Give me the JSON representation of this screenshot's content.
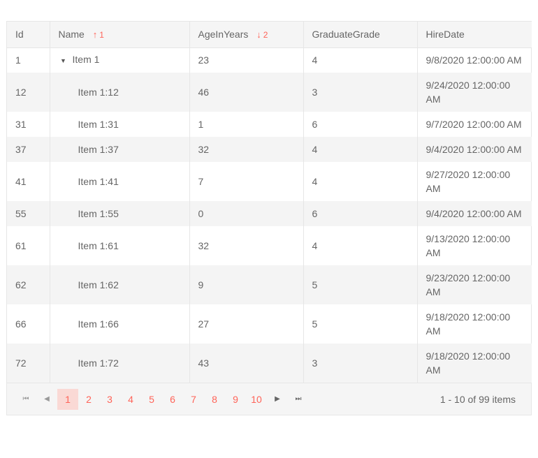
{
  "columns": [
    {
      "label": "Id"
    },
    {
      "label": "Name",
      "sort": {
        "direction": "asc",
        "arrow": "↑",
        "order": "1"
      }
    },
    {
      "label": "AgeInYears",
      "sort": {
        "direction": "desc",
        "arrow": "↓",
        "order": "2"
      }
    },
    {
      "label": "GraduateGrade"
    },
    {
      "label": "HireDate"
    }
  ],
  "rows": [
    {
      "id": "1",
      "name": "Item 1",
      "age": "23",
      "grade": "4",
      "hire": "9/8/2020 12:00:00 AM",
      "expander": "▼"
    },
    {
      "id": "12",
      "name": "Item 1:12",
      "age": "46",
      "grade": "3",
      "hire": "9/24/2020 12:00:00 AM"
    },
    {
      "id": "31",
      "name": "Item 1:31",
      "age": "1",
      "grade": "6",
      "hire": "9/7/2020 12:00:00 AM"
    },
    {
      "id": "37",
      "name": "Item 1:37",
      "age": "32",
      "grade": "4",
      "hire": "9/4/2020 12:00:00 AM"
    },
    {
      "id": "41",
      "name": "Item 1:41",
      "age": "7",
      "grade": "4",
      "hire": "9/27/2020 12:00:00 AM"
    },
    {
      "id": "55",
      "name": "Item 1:55",
      "age": "0",
      "grade": "6",
      "hire": "9/4/2020 12:00:00 AM"
    },
    {
      "id": "61",
      "name": "Item 1:61",
      "age": "32",
      "grade": "4",
      "hire": "9/13/2020 12:00:00 AM"
    },
    {
      "id": "62",
      "name": "Item 1:62",
      "age": "9",
      "grade": "5",
      "hire": "9/23/2020 12:00:00 AM"
    },
    {
      "id": "66",
      "name": "Item 1:66",
      "age": "27",
      "grade": "5",
      "hire": "9/18/2020 12:00:00 AM"
    },
    {
      "id": "72",
      "name": "Item 1:72",
      "age": "43",
      "grade": "3",
      "hire": "9/18/2020 12:00:00 AM"
    }
  ],
  "pager": {
    "first_icon": "⏮",
    "prev_icon": "◀",
    "next_icon": "▶",
    "last_icon": "⏭",
    "pages": [
      "1",
      "2",
      "3",
      "4",
      "5",
      "6",
      "7",
      "8",
      "9",
      "10"
    ],
    "current_page": "1",
    "info": "1 - 10 of 99 items"
  },
  "colors": {
    "accent": "#ff6358",
    "active_page_bg": "#fad9d5",
    "header_bg": "#f5f5f5",
    "alt_row_bg": "#f4f4f4",
    "border": "#e6e6e6"
  }
}
